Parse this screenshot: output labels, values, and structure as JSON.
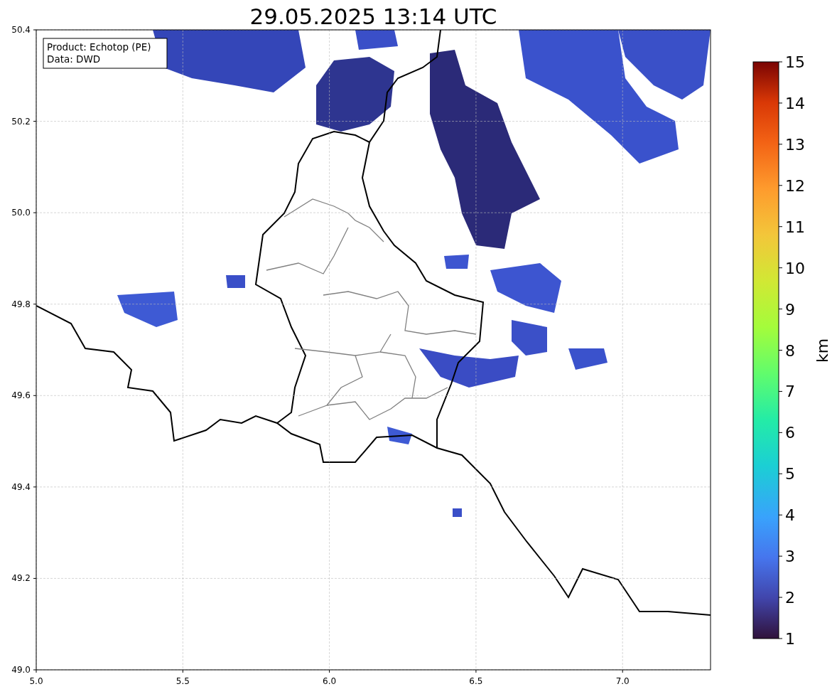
{
  "title": "29.05.2025 13:14 UTC",
  "info_box": [
    "Product: Echotop (PE)",
    "Data: DWD"
  ],
  "map": {
    "xticks": [
      "5.0",
      "5.5",
      "6.0",
      "6.5",
      "7.0"
    ],
    "yticks": [
      "50.4",
      "50.2",
      "50.0",
      "49.8",
      "49.6",
      "49.4",
      "49.2",
      "49.0"
    ]
  },
  "colorbar": {
    "label": "km",
    "ticks": [
      "15",
      "14",
      "13",
      "12",
      "11",
      "10",
      "9",
      "8",
      "7",
      "6",
      "5",
      "4",
      "3",
      "2",
      "1"
    ]
  }
}
